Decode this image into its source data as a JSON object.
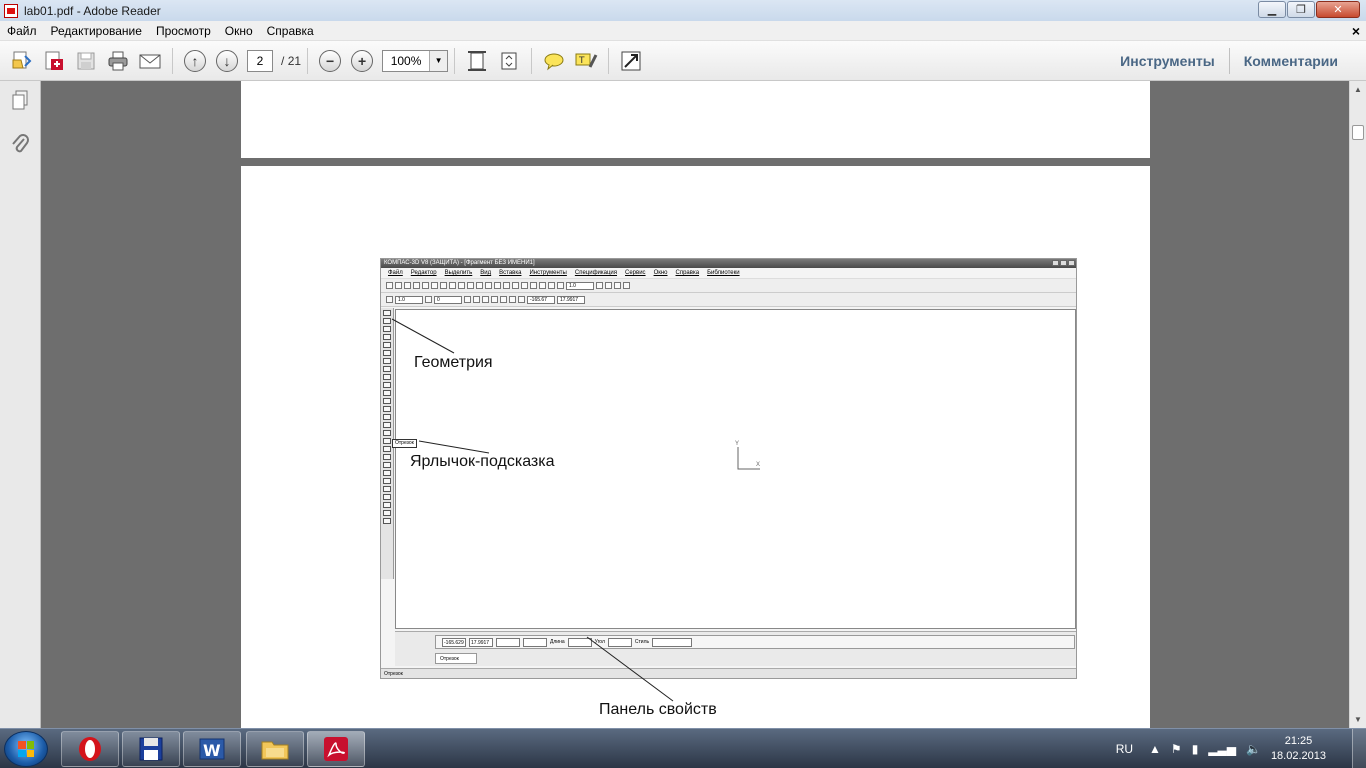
{
  "window": {
    "title": "lab01.pdf - Adobe Reader"
  },
  "menu": {
    "items": [
      "Файл",
      "Редактирование",
      "Просмотр",
      "Окно",
      "Справка"
    ],
    "close_glyph": "×"
  },
  "toolbar": {
    "current_page": "2",
    "page_separator": "/",
    "total_pages": "21",
    "zoom": "100%",
    "tools_label": "Инструменты",
    "comments_label": "Комментарии"
  },
  "kompas": {
    "title": "КОМПАС-3D V8 (ЗАЩИТА) - [Фрагмент БЕЗ ИМЕНИ1]",
    "menu": [
      "Файл",
      "Редактор",
      "Выделить",
      "Вид",
      "Вставка",
      "Инструменты",
      "Спецификация",
      "Сервис",
      "Окно",
      "Справка",
      "Библиотеки"
    ],
    "scale_value": "1.0",
    "line_scale": "1.0",
    "layer": "0",
    "coord_x": "-165.67",
    "coord_y": "17.9917",
    "props_x": "-165.629",
    "props_y": "17.9917",
    "length_label": "Длина",
    "angle_label": "Угол",
    "style_label": "Стиль",
    "tab_label": "Отрезок",
    "tooltip": "Отрезок",
    "status": "Отрезок",
    "axis_y": "Y",
    "axis_x": "X"
  },
  "callouts": {
    "geometry": "Геометрия",
    "tooltip": "Ярлычок-подсказка",
    "properties": "Панель свойств"
  },
  "taskbar": {
    "lang": "RU",
    "time": "21:25",
    "date": "18.02.2013"
  },
  "colors": {
    "accent": "#4a6785",
    "pdf_red": "#c8102e"
  }
}
